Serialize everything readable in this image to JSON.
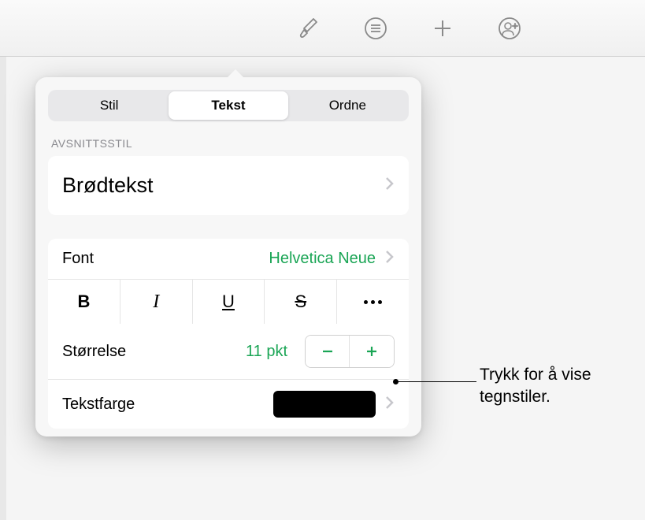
{
  "tabs": {
    "style": "Stil",
    "text": "Tekst",
    "arrange": "Ordne"
  },
  "sections": {
    "paragraphStyle": "AVSNITTSSTIL"
  },
  "paragraphStyle": {
    "name": "Brødtekst"
  },
  "font": {
    "label": "Font",
    "value": "Helvetica Neue"
  },
  "formatButtons": {
    "bold": "B",
    "italic": "I",
    "underline": "U",
    "strike": "S"
  },
  "size": {
    "label": "Størrelse",
    "value": "11 pkt"
  },
  "textColor": {
    "label": "Tekstfarge",
    "value": "#000000"
  },
  "callout": {
    "line1": "Trykk for å vise",
    "line2": "tegnstiler."
  }
}
